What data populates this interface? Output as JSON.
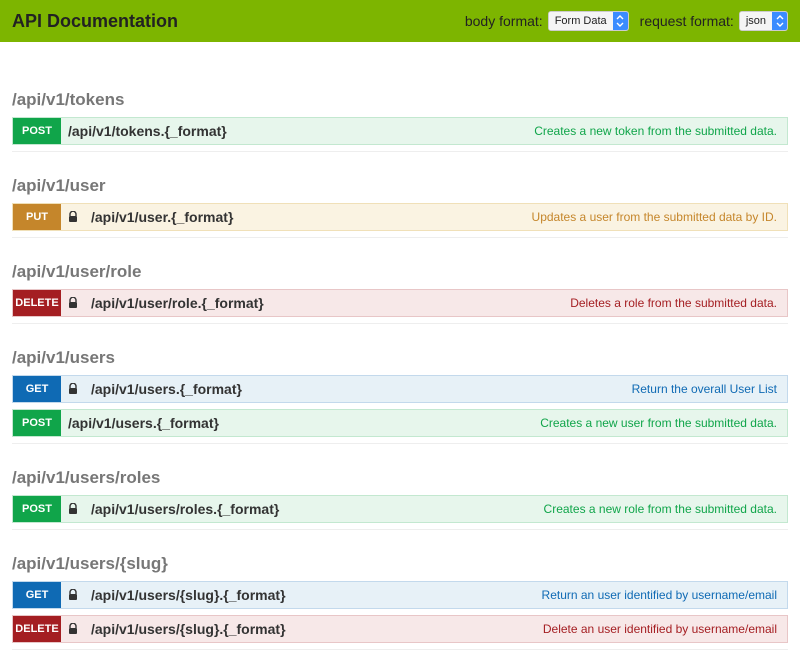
{
  "header": {
    "title": "API Documentation",
    "body_format_label": "body format:",
    "body_format_value": "Form Data",
    "request_format_label": "request format:",
    "request_format_value": "json"
  },
  "sections": [
    {
      "title": "/api/v1/tokens",
      "endpoints": [
        {
          "method": "POST",
          "lock": false,
          "path": "/api/v1/tokens.{_format}",
          "desc": "Creates a new token from the submitted data."
        }
      ]
    },
    {
      "title": "/api/v1/user",
      "endpoints": [
        {
          "method": "PUT",
          "lock": true,
          "path": "/api/v1/user.{_format}",
          "desc": "Updates a user from the submitted data by ID."
        }
      ]
    },
    {
      "title": "/api/v1/user/role",
      "endpoints": [
        {
          "method": "DELETE",
          "lock": true,
          "path": "/api/v1/user/role.{_format}",
          "desc": "Deletes a role from the submitted data."
        }
      ]
    },
    {
      "title": "/api/v1/users",
      "endpoints": [
        {
          "method": "GET",
          "lock": true,
          "path": "/api/v1/users.{_format}",
          "desc": "Return the overall User List"
        },
        {
          "method": "POST",
          "lock": false,
          "path": "/api/v1/users.{_format}",
          "desc": "Creates a new user from the submitted data."
        }
      ]
    },
    {
      "title": "/api/v1/users/roles",
      "endpoints": [
        {
          "method": "POST",
          "lock": true,
          "path": "/api/v1/users/roles.{_format}",
          "desc": "Creates a new role from the submitted data."
        }
      ]
    },
    {
      "title": "/api/v1/users/{slug}",
      "endpoints": [
        {
          "method": "GET",
          "lock": true,
          "path": "/api/v1/users/{slug}.{_format}",
          "desc": "Return an user identified by username/email"
        },
        {
          "method": "DELETE",
          "lock": true,
          "path": "/api/v1/users/{slug}.{_format}",
          "desc": "Delete an user identified by username/email"
        }
      ]
    }
  ]
}
